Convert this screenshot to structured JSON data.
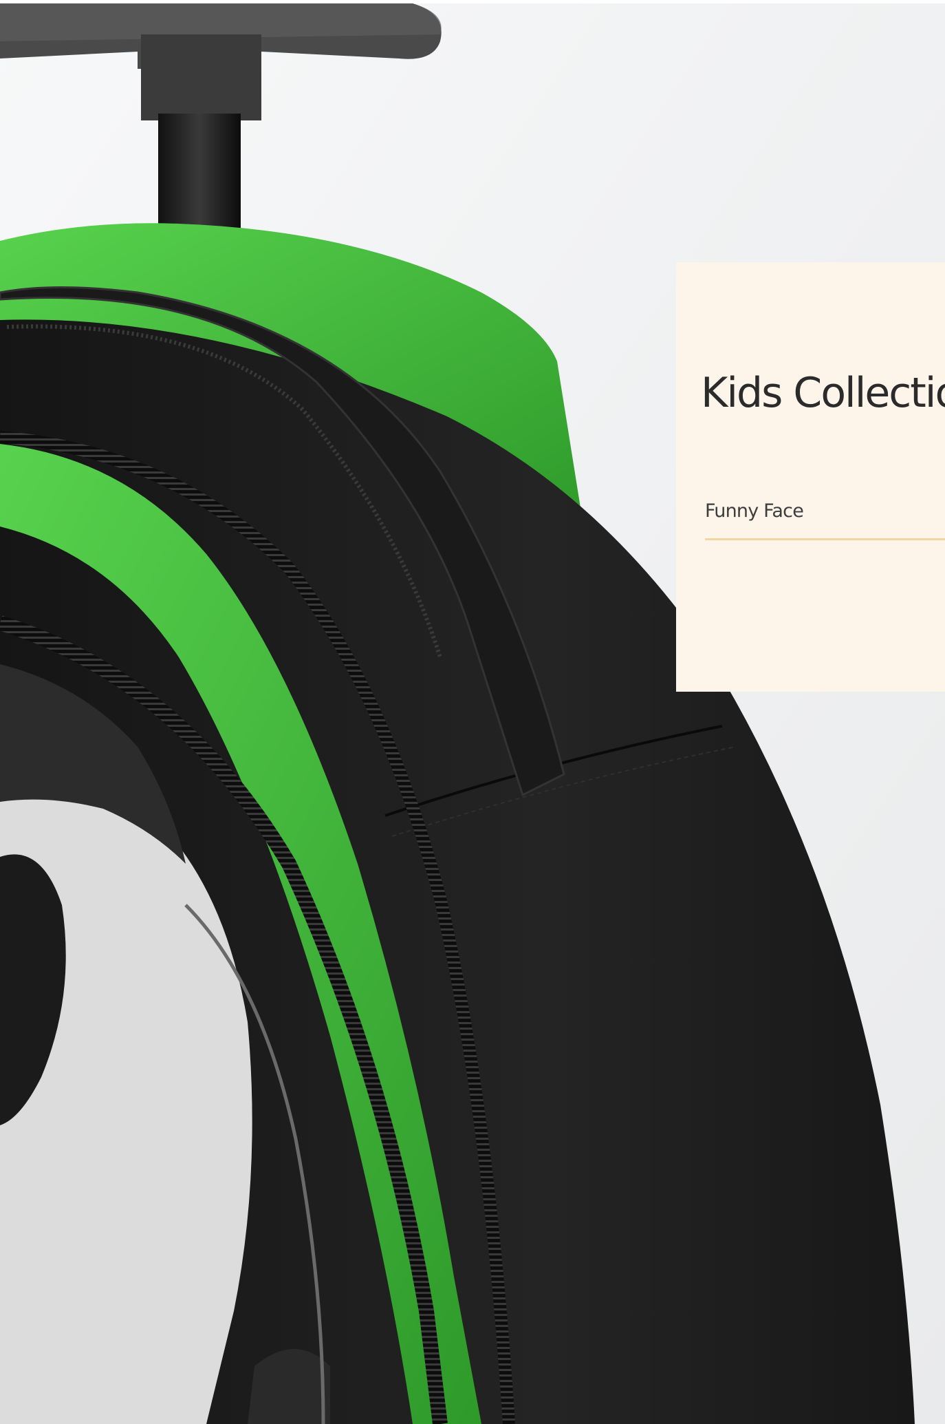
{
  "panel": {
    "title": "Kids Collection",
    "subtitle": "Funny Face",
    "background": "#fdf4ea",
    "rule_color": "#f2d59f"
  },
  "photo": {
    "subject": "trolley backpack",
    "accent_color": "#3fb53a",
    "body_color": "#1d1d1d",
    "background_color": "#eff0f1"
  }
}
